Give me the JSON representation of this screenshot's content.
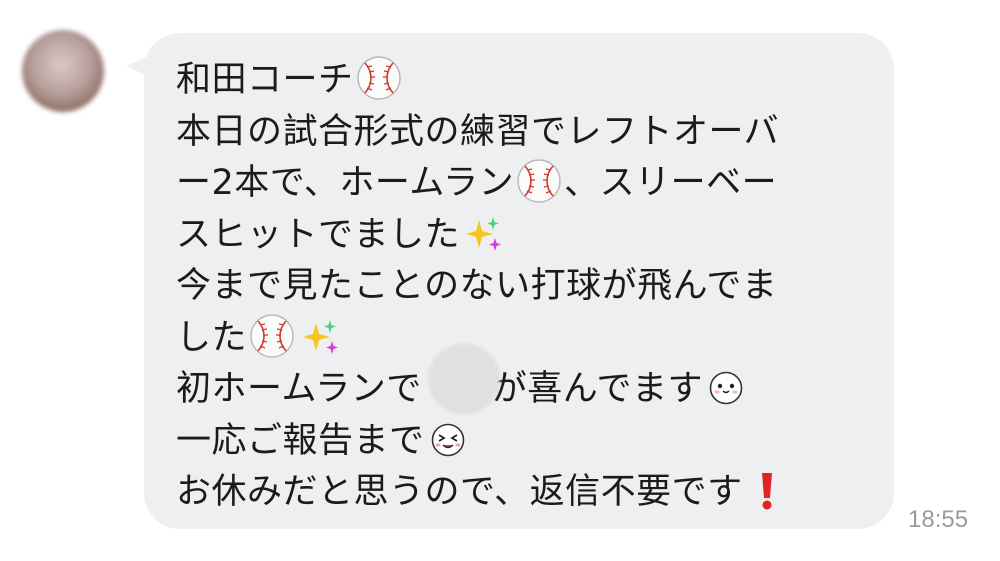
{
  "message": {
    "sender_line": "和田コーチ",
    "lines": [
      [
        "本日の試合形式の練習でレフトオーバ"
      ],
      [
        "ー2本で、ホームラン",
        "、スリーベー"
      ],
      [
        "スヒットでました"
      ],
      [
        "今まで見たことのない打球が飛んでま"
      ],
      [
        "した"
      ],
      [
        "初ホームランで",
        "が喜んでます"
      ],
      [
        "一応ご報告まで"
      ],
      [
        "お休みだと思うので、返信不要です"
      ]
    ],
    "timestamp": "18:55"
  },
  "icons": {
    "baseball": "baseball-emoji",
    "sparkles": "sparkles-emoji",
    "smile_face": "smiling-face-sticker",
    "squint_face": "laughing-face-sticker",
    "exclamation": "red-exclamation-emoji"
  },
  "colors": {
    "bubble_bg": "#eeeff1",
    "text": "#1b1b1b",
    "timestamp": "#9a9a9a",
    "exclamation": "#e02424"
  }
}
